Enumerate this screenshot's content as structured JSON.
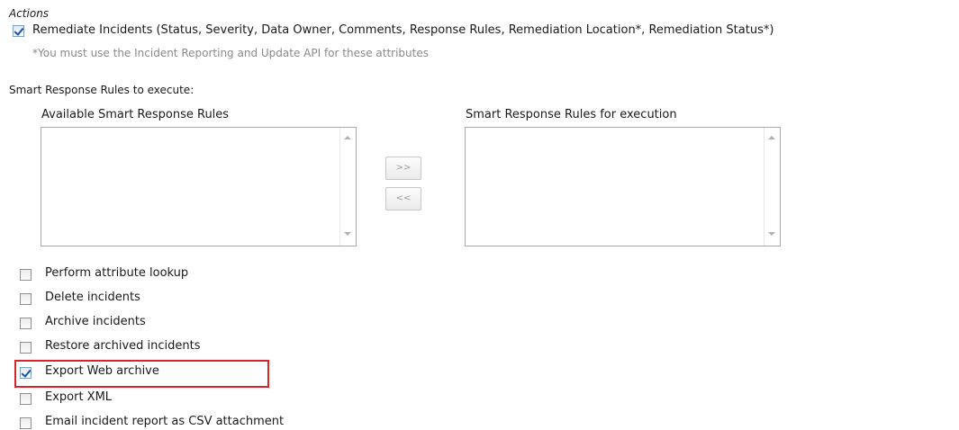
{
  "actions": {
    "title": "Actions",
    "remediate": {
      "label": "Remediate Incidents (Status, Severity, Data Owner, Comments, Response Rules, Remediation Location*, Remediation Status*)",
      "checked": true,
      "note": "*You must use the Incident Reporting and Update API for these attributes"
    }
  },
  "smart_rules": {
    "heading": "Smart Response Rules to execute:",
    "available_label": "Available Smart Response Rules",
    "execution_label": "Smart Response Rules for execution",
    "add_button": ">>",
    "remove_button": "<<"
  },
  "options": [
    {
      "label": "Perform attribute lookup",
      "checked": false
    },
    {
      "label": "Delete incidents",
      "checked": false
    },
    {
      "label": "Archive incidents",
      "checked": false
    },
    {
      "label": "Restore archived incidents",
      "checked": false
    },
    {
      "label": "Export Web archive",
      "checked": true,
      "highlighted": true
    },
    {
      "label": "Export XML",
      "checked": false
    },
    {
      "label": "Email incident report as CSV attachment",
      "checked": false
    }
  ],
  "colors": {
    "highlight": "#d9242b",
    "checkmark": "#1f4f9b",
    "note_text": "#8a8a8a"
  }
}
